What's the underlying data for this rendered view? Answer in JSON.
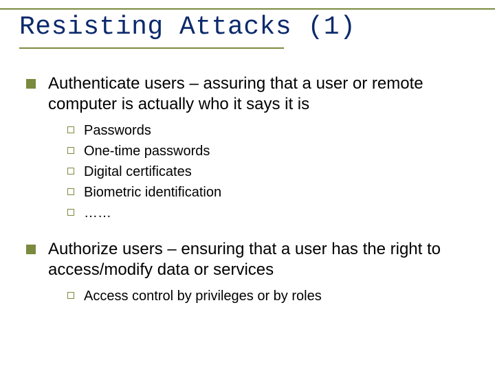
{
  "title": "Resisting Attacks (1)",
  "bullets": [
    {
      "text": "Authenticate users – assuring that a user or remote computer is actually who it says it is",
      "sub": [
        "Passwords",
        "One-time passwords",
        "Digital certificates",
        "Biometric identification",
        "……"
      ]
    },
    {
      "text": "Authorize users – ensuring that  a user has the right to access/modify data or services",
      "sub": [
        "Access control by privileges or by roles"
      ]
    }
  ]
}
